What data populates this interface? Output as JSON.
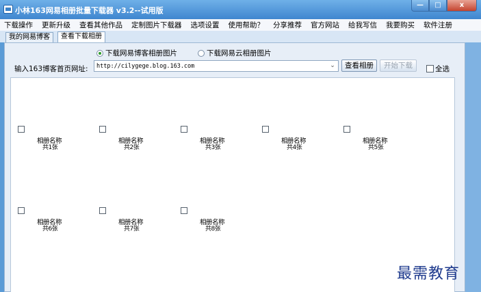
{
  "window": {
    "title": "小林163网易相册批量下载器 v3.2--试用版",
    "minimize_glyph": "—",
    "maximize_glyph": "□",
    "close_glyph": "x"
  },
  "menu": [
    "下载操作",
    "更新升级",
    "查看其他作品",
    "定制图片下载器",
    "选项设置",
    "使用帮助？",
    "分享推荐",
    "官方网站",
    "给我写信",
    "我要购买",
    "软件注册"
  ],
  "tabs": [
    {
      "label": "我的网易博客",
      "active": false
    },
    {
      "label": "查看下载相册",
      "active": true
    }
  ],
  "source_options": {
    "blog_label": "下载网易博客相册图片",
    "cloud_label": "下载网易云相册图片",
    "selected": "blog"
  },
  "url_field": {
    "label": "输入163博客首页网址:",
    "value": "http://cilygege.blog.163.com"
  },
  "buttons": {
    "view_album": "查看相册",
    "start_download": "开始下载",
    "select_all": "全选"
  },
  "albums": [
    {
      "name": "相册名称",
      "count": "共1张"
    },
    {
      "name": "相册名称",
      "count": "共2张"
    },
    {
      "name": "相册名称",
      "count": "共3张"
    },
    {
      "name": "相册名称",
      "count": "共4张"
    },
    {
      "name": "相册名称",
      "count": "共5张"
    },
    {
      "name": "相册名称",
      "count": "共6张"
    },
    {
      "name": "相册名称",
      "count": "共7张"
    },
    {
      "name": "相册名称",
      "count": "共8张"
    }
  ],
  "watermark": "最需教育",
  "colors": {
    "titlebar": "#3f86cf",
    "panel": "#e7eef7",
    "radio_check": "#2a9a2a"
  }
}
